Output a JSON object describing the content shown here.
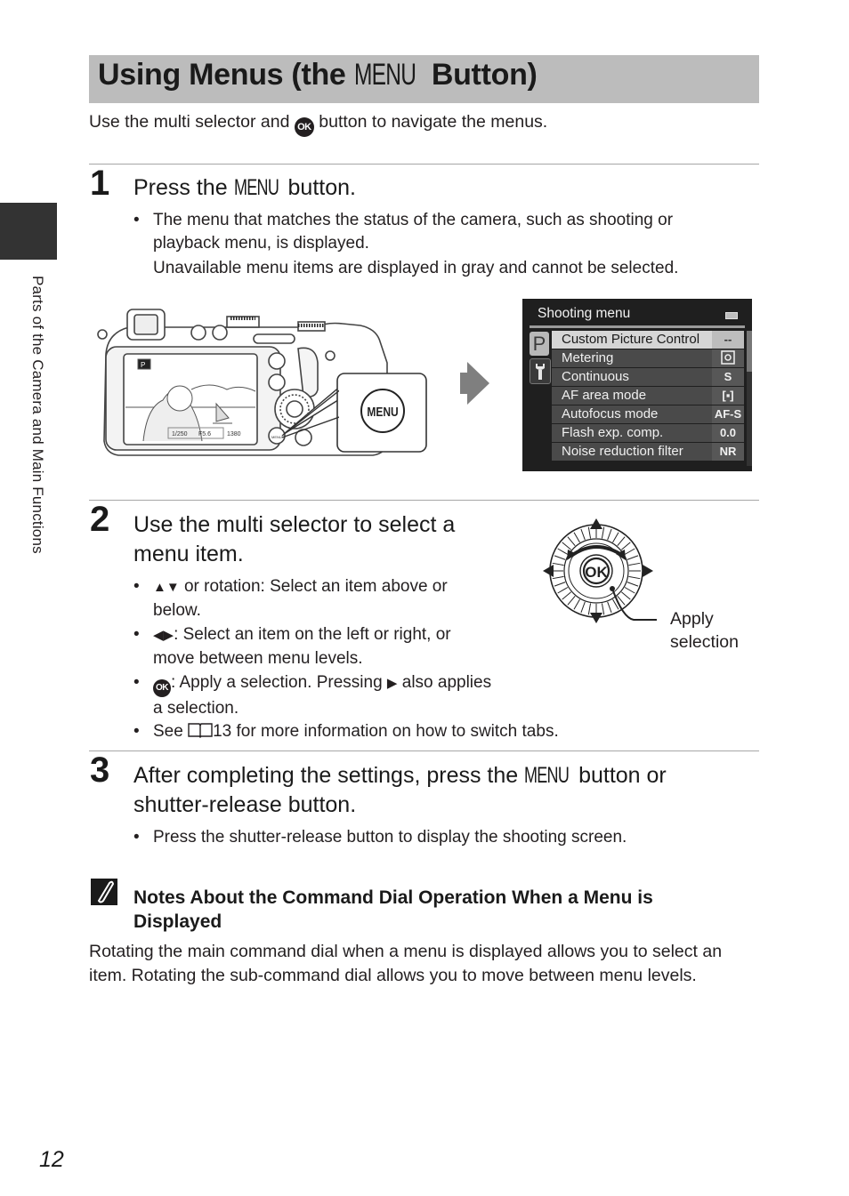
{
  "sidebar": {
    "section_label": "Parts of the Camera and Main Functions"
  },
  "header": {
    "title_before": "Using Menus (the ",
    "title_menu_glyph": "MENU",
    "title_after": " Button)",
    "intro_before": "Use the multi selector and ",
    "intro_ok_glyph": "OK",
    "intro_after": " button to navigate the menus."
  },
  "steps": [
    {
      "number": "1",
      "heading_before": "Press the ",
      "heading_menu_glyph": "MENU",
      "heading_after": " button.",
      "bullets": [
        {
          "line1": "The menu that matches the status of the camera, such as shooting or",
          "line2": "playback menu, is displayed.",
          "line3": "Unavailable menu items are displayed in gray and cannot be selected."
        }
      ]
    },
    {
      "number": "2",
      "heading_line1": "Use the multi selector to select a",
      "heading_line2": "menu item.",
      "bullets": [
        {
          "glyph": "▲▼",
          "line1": " or rotation: Select an item above or",
          "line2": "below."
        },
        {
          "glyph": "◀▶",
          "line1": ": Select an item on the left or right, or",
          "line2": "move between menu levels."
        },
        {
          "glyph": "OK",
          "line1": ": Apply a selection. Pressing ",
          "glyph2": "▶",
          "line1b": " also applies",
          "line2": "a selection."
        },
        {
          "line1_before": "See ",
          "book_glyph": "book-icon",
          "line1_after": "13 for more information on how to switch tabs."
        }
      ]
    },
    {
      "number": "3",
      "heading_before": "After completing the settings, press the ",
      "heading_menu_glyph": "MENU",
      "heading_after": " button or",
      "heading_line2": "shutter-release button.",
      "bullets": [
        {
          "line1": "Press the shutter-release button to display the shooting screen."
        }
      ]
    }
  ],
  "camera_illustration": {
    "menu_callout_label": "MENU",
    "lcd_mode": "P",
    "lcd_shutter": "1/250",
    "lcd_aperture": "F5.6",
    "lcd_shots": "1380"
  },
  "shooting_menu": {
    "title": "Shooting menu",
    "tabs": [
      "P",
      "wrench"
    ],
    "items": [
      {
        "label": "Custom Picture Control",
        "value": "--",
        "selected": true
      },
      {
        "label": "Metering",
        "value": "matrix-icon",
        "selected": false
      },
      {
        "label": "Continuous",
        "value": "S",
        "selected": false
      },
      {
        "label": "AF area mode",
        "value": "[▪]",
        "selected": false
      },
      {
        "label": "Autofocus mode",
        "value": "AF-S",
        "selected": false
      },
      {
        "label": "Flash exp. comp.",
        "value": "0.0",
        "selected": false
      },
      {
        "label": "Noise reduction filter",
        "value": "NR",
        "selected": false
      }
    ]
  },
  "dial": {
    "center_label": "OK",
    "callout_line1": "Apply",
    "callout_line2": "selection"
  },
  "note": {
    "heading_line1": "Notes About the Command Dial Operation When a Menu is",
    "heading_line2": "Displayed",
    "body_line1": "Rotating the main command dial when a menu is displayed allows you to select an",
    "body_line2": "item. Rotating the sub-command dial allows you to move between menu levels."
  },
  "footer": {
    "page_number": "12"
  },
  "colors": {
    "title_bar": "#bcbcbc",
    "side_tab": "#333333",
    "rule": "#a6a6a6",
    "lcd_bg": "#1f1f1f",
    "lcd_selected": "#d6d6d6"
  }
}
